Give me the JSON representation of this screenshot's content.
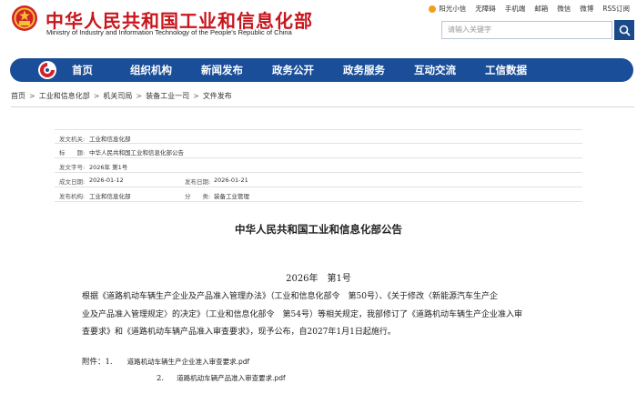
{
  "header": {
    "title": "中华人民共和国工业和信息化部",
    "subtitle": "Ministry of Industry and Information Technology of the People's Republic of China",
    "top_links": [
      "阳光小信",
      "无障碍",
      "手机端",
      "邮箱",
      "微信",
      "微博",
      "RSS订阅"
    ],
    "search_placeholder": "请输入关键字"
  },
  "nav": {
    "items": [
      "首页",
      "组织机构",
      "新闻发布",
      "政务公开",
      "政务服务",
      "互动交流",
      "工信数据"
    ]
  },
  "breadcrumb": [
    "首页",
    "工业和信息化部",
    "机关司局",
    "装备工业一司",
    "文件发布"
  ],
  "meta": {
    "issuer_label": "发文机关:",
    "issuer": "工业和信息化部",
    "title_label": "标　　题:",
    "title": "中华人民共和国工业和信息化部公告",
    "doc_number_label": "发文字号:",
    "doc_number": "2026年 第1号",
    "created_label": "成文日期:",
    "created": "2026-01-12",
    "published_label": "发布日期:",
    "published": "2026-01-21",
    "publisher_label": "发布机构:",
    "publisher": "工业和信息化部",
    "category_label": "分　　类:",
    "category": "装备工业管理"
  },
  "document": {
    "heading": "中华人民共和国工业和信息化部公告",
    "number": "2026年　第1号",
    "body_line1": "根据《道路机动车辆生产企业及产品准入管理办法》（工业和信息化部令　第50号）、《关于修改〈新能源汽车生产企",
    "body_line2": "业及产品准入管理规定〉的决定》（工业和信息化部令　第54号）等相关规定，我部修订了《道路机动车辆生产企业准入审",
    "body_line3": "查要求》和《道路机动车辆产品准入审查要求》，现予公布，自2027年1月1日起施行。",
    "attachment_label": "附件：1.",
    "attachment1": "道路机动车辆生产企业准入审查要求.pdf",
    "attachment2_num": "2.",
    "attachment2": "道路机动车辆产品准入审查要求.pdf"
  }
}
